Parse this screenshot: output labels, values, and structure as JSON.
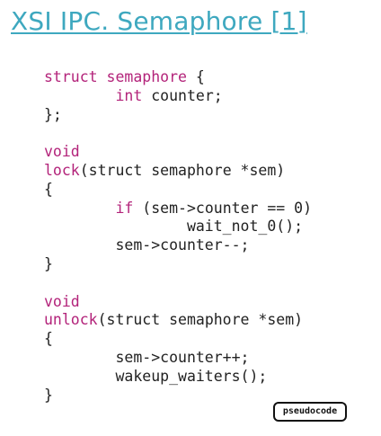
{
  "title": "XSI IPC. Semaphore [1]",
  "code_lines": [
    [
      {
        "t": "struct",
        "k": true
      },
      {
        "t": " "
      },
      {
        "t": "semaphore",
        "k": true
      },
      {
        "t": " {"
      }
    ],
    [
      {
        "t": "        "
      },
      {
        "t": "int",
        "k": true
      },
      {
        "t": " counter;"
      }
    ],
    [
      {
        "t": "};"
      }
    ],
    [],
    [
      {
        "t": "void",
        "k": true
      }
    ],
    [
      {
        "t": "lock",
        "k": true
      },
      {
        "t": "(struct semaphore *sem)"
      }
    ],
    [
      {
        "t": "{"
      }
    ],
    [
      {
        "t": "        "
      },
      {
        "t": "if",
        "k": true
      },
      {
        "t": " (sem->counter == 0)"
      }
    ],
    [
      {
        "t": "                wait_not_0();"
      }
    ],
    [
      {
        "t": "        sem->counter--;"
      }
    ],
    [
      {
        "t": "}"
      }
    ],
    [],
    [
      {
        "t": "void",
        "k": true
      }
    ],
    [
      {
        "t": "unlock",
        "k": true
      },
      {
        "t": "(struct semaphore *sem)"
      }
    ],
    [
      {
        "t": "{"
      }
    ],
    [
      {
        "t": "        sem->counter++;"
      }
    ],
    [
      {
        "t": "        wakeup_waiters();"
      }
    ],
    [
      {
        "t": "}"
      }
    ]
  ],
  "badge": "pseudocode",
  "colors": {
    "title": "#3ea8bf",
    "keyword": "#b3237a",
    "text": "#222222"
  }
}
